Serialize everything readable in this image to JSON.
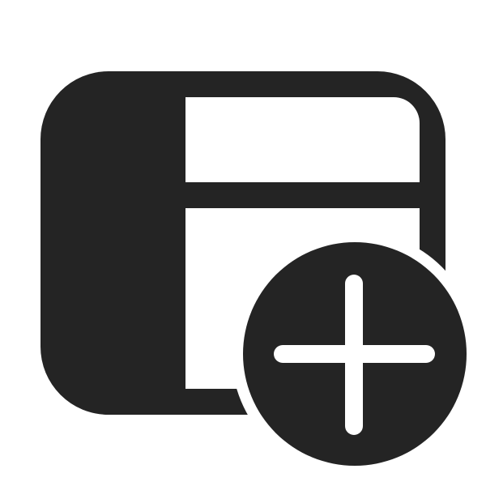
{
  "icon": {
    "name": "table-add-icon",
    "parts": [
      "table-icon",
      "add-circle-icon",
      "plus-icon"
    ]
  },
  "colors": {
    "glyph": "#242424",
    "background": "#ffffff"
  }
}
